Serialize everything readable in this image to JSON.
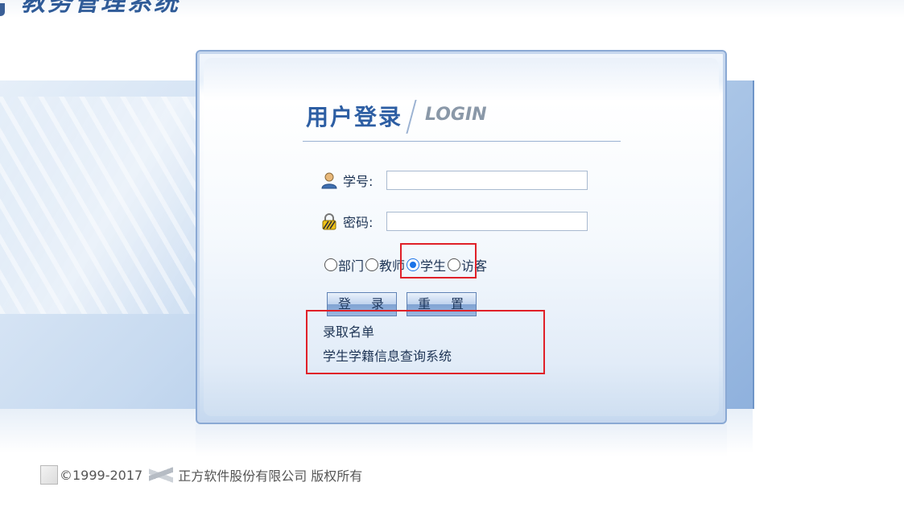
{
  "header": {
    "title": "教务管理系统"
  },
  "login": {
    "heading_cn": "用户登录",
    "heading_en": "LOGIN",
    "username_label": "学号:",
    "username_value": "",
    "password_label": "密码:",
    "password_value": "",
    "roles": [
      {
        "label": "部门",
        "selected": false
      },
      {
        "label": "教师",
        "selected": false
      },
      {
        "label": "学生",
        "selected": true
      },
      {
        "label": "访客",
        "selected": false
      }
    ],
    "login_button": "登 录",
    "reset_button": "重 置",
    "links": [
      "录取名单",
      "学生学籍信息查询系统"
    ]
  },
  "footer": {
    "copyright": "©1999-2017",
    "company": "正方软件股份有限公司 版权所有"
  },
  "colors": {
    "accent": "#2d5ea3",
    "highlight": "#e02028",
    "radio_selected": "#1a73e8"
  },
  "icons": {
    "username": "user-icon",
    "password": "lock-icon",
    "footer_logo": "company-logo-icon",
    "brand": "brand-icon"
  }
}
